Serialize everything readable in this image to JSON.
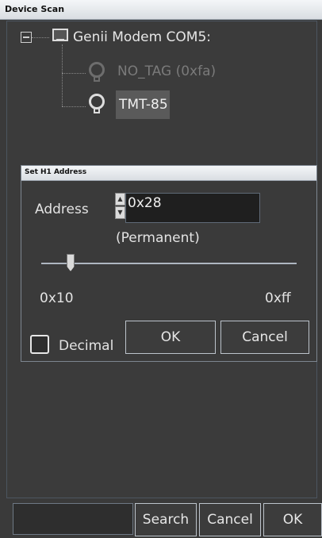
{
  "window": {
    "title": "Device Scan"
  },
  "tree": {
    "root_label": "Genii Modem COM5:",
    "children": [
      {
        "label": "NO_TAG (0xfa)",
        "dim": true
      },
      {
        "label": "TMT-85",
        "selected": true
      }
    ]
  },
  "dialog": {
    "title": "Set H1 Address",
    "address_label": "Address",
    "address_value": "0x28",
    "permanent_label": "(Permanent)",
    "slider": {
      "min_label": "0x10",
      "max_label": "0xff",
      "value": "0x28"
    },
    "decimal_label": "Decimal",
    "decimal_checked": false,
    "ok_label": "OK",
    "cancel_label": "Cancel"
  },
  "footer": {
    "search_value": "",
    "search_label": "Search",
    "cancel_label": "Cancel",
    "ok_label": "OK"
  },
  "icons": [
    "collapse-icon",
    "computer-monitor-icon",
    "device-bulb-icon"
  ]
}
